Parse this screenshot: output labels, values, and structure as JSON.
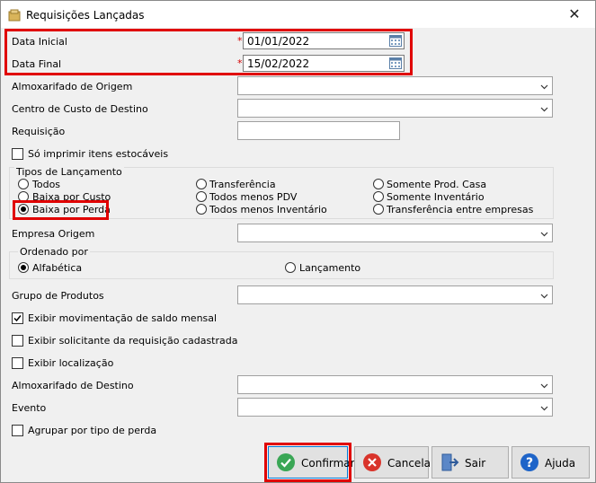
{
  "window": {
    "title": "Requisições Lançadas",
    "close_glyph": "✕"
  },
  "fields": {
    "data_inicial_label": "Data Inicial",
    "data_final_label": "Data Final",
    "required_mark": "*",
    "data_inicial_value": "01/01/2022",
    "data_final_value": "15/02/2022",
    "almox_origem_label": "Almoxarifado de Origem",
    "centro_custo_label": "Centro de Custo de Destino",
    "requisicao_label": "Requisição",
    "so_imprimir_label": "Só imprimir itens estocáveis",
    "empresa_origem_label": "Empresa Origem",
    "grupo_produtos_label": "Grupo de Produtos",
    "exibir_mov_label": "Exibir movimentação de saldo mensal",
    "exibir_solicitante_label": "Exibir solicitante da requisição cadastrada",
    "exibir_localizacao_label": "Exibir localização",
    "almox_destino_label": "Almoxarifado de Destino",
    "evento_label": "Evento",
    "agrupar_label": "Agrupar por tipo de perda"
  },
  "tipos": {
    "legend": "Tipos de Lançamento",
    "options": [
      "Todos",
      "Baixa por Custo",
      "Baixa por Perda",
      "Transferência",
      "Todos menos PDV",
      "Todos menos Inventário",
      "Somente Prod. Casa",
      "Somente Inventário",
      "Transferência entre empresas"
    ],
    "selected": "Baixa por Perda"
  },
  "ordenado": {
    "legend": "Ordenado por",
    "options": [
      "Alfabética",
      "Lançamento"
    ],
    "selected": "Alfabética"
  },
  "checks": {
    "so_imprimir": false,
    "exibir_mov": true,
    "exibir_solicitante": false,
    "exibir_localizacao": false,
    "agrupar": false
  },
  "buttons": {
    "confirmar": "Confirmar",
    "cancelar": "Cancelar",
    "sair": "Sair",
    "ajuda": "Ajuda"
  },
  "colors": {
    "highlight": "#e00000",
    "confirm_icon": "#3aa655",
    "cancel_icon": "#d9342b",
    "help_icon": "#1e64c8"
  }
}
